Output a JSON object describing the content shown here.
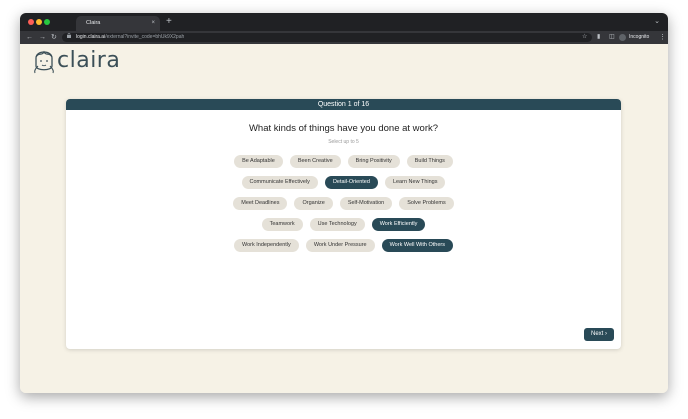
{
  "browser": {
    "tab_title": "Claira",
    "tab_close": "×",
    "new_tab": "+",
    "url_host": "login.claira.ai",
    "url_path": "/external?invite_code=bhUk9X2pah",
    "incognito_label": "Incognito"
  },
  "brand": {
    "name": "claira",
    "primary_color": "#294a57",
    "background_color": "#f6f2e6"
  },
  "quiz": {
    "progress": "Question 1 of 16",
    "question": "What kinds of things have you done at work?",
    "hint": "Select up to 5",
    "rows": [
      [
        {
          "label": "Be Adaptable",
          "selected": false
        },
        {
          "label": "Been Creative",
          "selected": false
        },
        {
          "label": "Bring Positivity",
          "selected": false
        },
        {
          "label": "Build Things",
          "selected": false
        }
      ],
      [
        {
          "label": "Communicate Effectively",
          "selected": false
        },
        {
          "label": "Detail-Oriented",
          "selected": true
        },
        {
          "label": "Learn New Things",
          "selected": false
        }
      ],
      [
        {
          "label": "Meet Deadlines",
          "selected": false
        },
        {
          "label": "Organize",
          "selected": false
        },
        {
          "label": "Self-Motivation",
          "selected": false
        },
        {
          "label": "Solve Problems",
          "selected": false
        }
      ],
      [
        {
          "label": "Teamwork",
          "selected": false
        },
        {
          "label": "Use Technology",
          "selected": false
        },
        {
          "label": "Work Efficiently",
          "selected": true
        }
      ],
      [
        {
          "label": "Work Independently",
          "selected": false
        },
        {
          "label": "Work Under Pressure",
          "selected": false
        },
        {
          "label": "Work Well With Others",
          "selected": true
        }
      ]
    ],
    "next_label": "Next"
  }
}
